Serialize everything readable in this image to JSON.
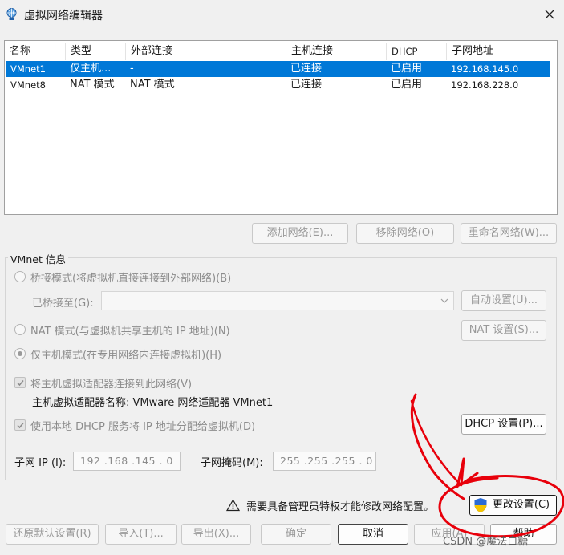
{
  "window": {
    "title": "虚拟网络编辑器"
  },
  "table": {
    "columns": [
      "名称",
      "类型",
      "外部连接",
      "主机连接",
      "DHCP",
      "子网地址"
    ],
    "rows": [
      {
        "name": "VMnet1",
        "type": "仅主机...",
        "external": "-",
        "host": "已连接",
        "dhcp": "已启用",
        "subnet": "192.168.145.0",
        "selected": true
      },
      {
        "name": "VMnet8",
        "type": "NAT 模式",
        "external": "NAT 模式",
        "host": "已连接",
        "dhcp": "已启用",
        "subnet": "192.168.228.0",
        "selected": false
      }
    ]
  },
  "list_buttons": {
    "add": "添加网络(E)...",
    "remove": "移除网络(O)",
    "rename": "重命名网络(W)..."
  },
  "info": {
    "group_title": "VMnet 信息",
    "bridge_label": "桥接模式(将虚拟机直接连接到外部网络)(B)",
    "bridged_to_label": "已桥接至(G):",
    "auto_button": "自动设置(U)...",
    "nat_label": "NAT 模式(与虚拟机共享主机的 IP 地址)(N)",
    "nat_button": "NAT 设置(S)...",
    "hostonly_label": "仅主机模式(在专用网络内连接虚拟机)(H)",
    "connect_adapter_label": "将主机虚拟适配器连接到此网络(V)",
    "adapter_name": "主机虚拟适配器名称: VMware 网络适配器 VMnet1",
    "dhcp_label": "使用本地 DHCP 服务将 IP 地址分配给虚拟机(D)",
    "dhcp_button": "DHCP 设置(P)...",
    "subnet_ip_label": "子网 IP (I):",
    "subnet_ip": "192 .168 .145 . 0",
    "mask_label": "子网掩码(M):",
    "mask": "255 .255 .255 . 0"
  },
  "admin": {
    "notice": "需要具备管理员特权才能修改网络配置。",
    "change_button": "更改设置(C)"
  },
  "footer": {
    "restore": "还原默认设置(R)",
    "import": "导入(T)...",
    "export": "导出(X)...",
    "ok": "确定",
    "cancel": "取消",
    "apply": "应用(A)",
    "help": "帮助"
  },
  "watermark": "CSDN @魔法白糖",
  "colors": {
    "selection": "#0078d7",
    "annotation": "#e8000b",
    "shield_blue": "#2a6bd6",
    "shield_yellow": "#f5c400"
  }
}
